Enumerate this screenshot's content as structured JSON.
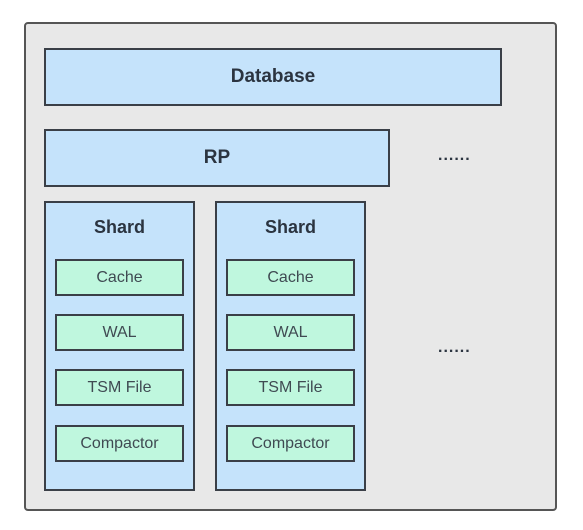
{
  "database": "Database",
  "rp": "RP",
  "ellipsis": "......",
  "shards": [
    {
      "title": "Shard",
      "components": [
        "Cache",
        "WAL",
        "TSM File",
        "Compactor"
      ]
    },
    {
      "title": "Shard",
      "components": [
        "Cache",
        "WAL",
        "TSM File",
        "Compactor"
      ]
    }
  ]
}
